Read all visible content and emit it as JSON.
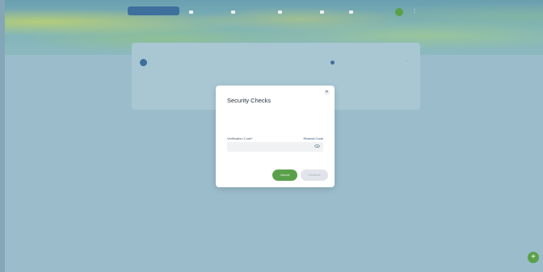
{
  "header": {
    "account_label": "",
    "nav": [
      {
        "label": ""
      },
      {
        "label": ""
      },
      {
        "label": ""
      },
      {
        "label": ""
      },
      {
        "label": ""
      }
    ],
    "breadcrumb": ""
  },
  "card": {
    "label": "",
    "name": "",
    "subtitle": "",
    "status": ""
  },
  "modal": {
    "title": "Security Checks",
    "body": "",
    "field_label": "Verification Code*",
    "resend": "Resend Code",
    "input_placeholder": "",
    "cancel_label": "Cancel",
    "continue_label": "Continue"
  },
  "fab_icon": "plus-icon",
  "colors": {
    "accent_green": "#5aa04a",
    "primary_blue": "#3f6f9c",
    "overlay": "#9bbccb"
  }
}
